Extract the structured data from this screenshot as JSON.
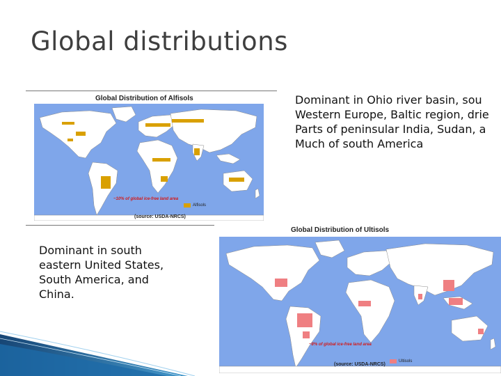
{
  "slide": {
    "title": "Global distributions",
    "right_text": [
      "Dominant in Ohio river basin, sou",
      "Western Europe, Baltic region, drie",
      "Parts of peninsular India, Sudan, a",
      "Much of south America"
    ],
    "left_text": [
      "Dominant in south",
      "eastern United States,",
      "South America, and",
      "China."
    ]
  },
  "maps": {
    "alfisols": {
      "title": "Global Distribution of Alfisols",
      "note": "~10% of global ice-free land area",
      "source": "(source: USDA-NRCS)",
      "legend_label": "Alfisols",
      "soil_color": "#d9a000",
      "ocean_color": "#7fa6ea"
    },
    "ultisols": {
      "title": "Global Distribution of Ultisols",
      "note": "~8% of global ice-free land area",
      "source": "(source: USDA-NRCS)",
      "legend_label": "Ultisols",
      "soil_color": "#ef7f82",
      "ocean_color": "#7fa6ea"
    }
  }
}
